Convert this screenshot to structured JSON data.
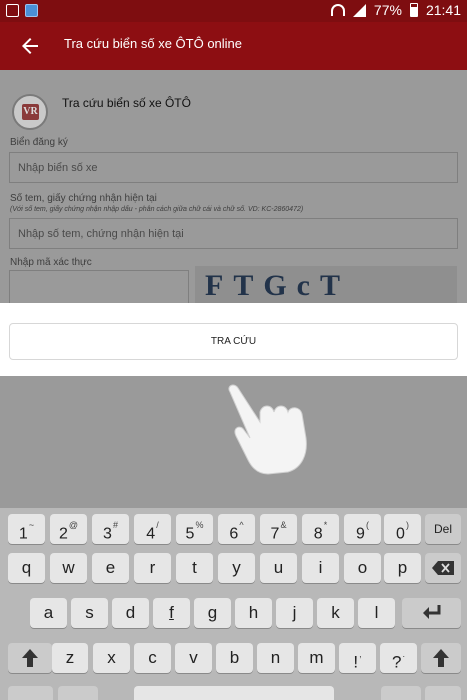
{
  "status_bar": {
    "battery": "77%",
    "time": "21:41"
  },
  "toolbar": {
    "title": "Tra cứu biển số xe ÔTÔ online"
  },
  "form": {
    "title": "Tra cứu biển số xe ÔTÔ",
    "plate_label": "Biển đăng ký",
    "plate_placeholder": "Nhập biển số xe",
    "cert_label": "Số tem, giấy chứng nhận hiện tại",
    "cert_hint": "(Với số tem, giấy chứng nhận nhập dấu - phân cách giữa chữ cái và chữ số. VD: KC-2860472)",
    "cert_placeholder": "Nhập số tem, chứng nhận hiện tại",
    "captcha_label": "Nhập mã xác thực",
    "captcha_text": "FTGcT",
    "search_button": "TRA CỨU"
  },
  "logo": {
    "letters": "VR"
  },
  "keyboard": {
    "numbers": [
      {
        "main": "1",
        "sup": "~"
      },
      {
        "main": "2",
        "sup": "@"
      },
      {
        "main": "3",
        "sup": "#"
      },
      {
        "main": "4",
        "sup": "/"
      },
      {
        "main": "5",
        "sup": "%"
      },
      {
        "main": "6",
        "sup": "^"
      },
      {
        "main": "7",
        "sup": "&"
      },
      {
        "main": "8",
        "sup": "*"
      },
      {
        "main": "9",
        "sup": "("
      },
      {
        "main": "0",
        "sup": ")"
      }
    ],
    "del": "Del",
    "row1": [
      "q",
      "w",
      "e",
      "r",
      "t",
      "y",
      "u",
      "i",
      "o",
      "p"
    ],
    "row2": [
      "a",
      "s",
      "d",
      "f",
      "g",
      "h",
      "j",
      "k",
      "l"
    ],
    "row3": [
      "z",
      "x",
      "c",
      "v",
      "b",
      "n",
      "m",
      "!",
      "?"
    ],
    "row3_sups": [
      "",
      "",
      "",
      "",
      "",
      "",
      "",
      ",",
      "."
    ],
    "row2_sups": [
      "",
      "",
      "",
      "",
      "",
      "",
      "",
      "",
      ""
    ]
  },
  "colors": {
    "toolbar": "#8d0e12",
    "status_bar": "#7e0d10",
    "dim": "#9a9a9a"
  }
}
